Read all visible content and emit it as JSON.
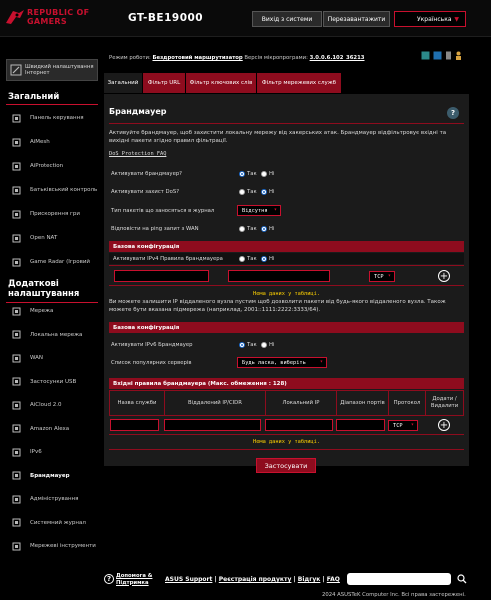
{
  "header": {
    "brand_line1": "REPUBLIC OF",
    "brand_line2": "GAMERS",
    "model": "GT-BE19000",
    "logout": "Вихід з системи",
    "reboot": "Перезавантажити",
    "language": "Українська"
  },
  "sidebar": {
    "quick_setup": "Швидкий налаштування Інтернет",
    "general_title": "Загальний",
    "general_items": [
      {
        "label": "Панель керування",
        "icon": "dashboard-icon"
      },
      {
        "label": "AiMesh",
        "icon": "mesh-icon"
      },
      {
        "label": "AiProtection",
        "icon": "shield-icon"
      },
      {
        "label": "Батьківський контроль",
        "icon": "parental-icon"
      },
      {
        "label": "Прискорення гри",
        "icon": "game-boost-icon"
      },
      {
        "label": "Open NAT",
        "icon": "nat-icon"
      },
      {
        "label": "Game Radar (Ігровий",
        "icon": "radar-icon"
      }
    ],
    "advanced_title": "Додаткові налаштування",
    "advanced_items": [
      {
        "label": "Мережа",
        "icon": "network-icon"
      },
      {
        "label": "Локальна мережа",
        "icon": "lan-icon"
      },
      {
        "label": "WAN",
        "icon": "globe-icon"
      },
      {
        "label": "Застосунки USB",
        "icon": "usb-icon"
      },
      {
        "label": "AiCloud 2.0",
        "icon": "cloud-icon"
      },
      {
        "label": "Amazon Alexa",
        "icon": "alexa-icon"
      },
      {
        "label": "IPv6",
        "icon": "ipv6-icon"
      },
      {
        "label": "Брандмауер",
        "icon": "firewall-icon",
        "active": true
      },
      {
        "label": "Адміністрування",
        "icon": "admin-icon"
      },
      {
        "label": "Системний журнал",
        "icon": "log-icon"
      },
      {
        "label": "Мережеві інструменти",
        "icon": "tools-icon"
      }
    ]
  },
  "topinfo": {
    "mode_label": "Режим роботи:",
    "mode_value": "Бездротовий маршрутизатор",
    "fw_label": "Версія мікропрограми:",
    "fw_value": "3.0.0.6.102_36213"
  },
  "tabs": [
    "Загальний",
    "Фільтр URL",
    "Фільтр ключових слів",
    "Фільтр мережевих служб"
  ],
  "panel": {
    "title": "Брандмауер",
    "description": "Активуйте брандмауер, щоб захистити локальну мережу від хакерських атак. Брандмауер відфільтровує вхідні та вихідні пакети згідно правил фільтрації.",
    "faq": "DoS Protection FAQ",
    "settings": [
      {
        "label": "Активувати брандмауер?",
        "type": "radio",
        "value": "yes"
      },
      {
        "label": "Активувати захист DoS?",
        "type": "radio",
        "value": "no"
      },
      {
        "label": "Тип пакетів що заносяться в журнал",
        "type": "select",
        "value": "Відсутня"
      },
      {
        "label": "Відповісти на ping запит з WAN",
        "type": "radio",
        "value": "no"
      }
    ],
    "yes": "Так",
    "no": "Ні",
    "basic_config": "Базова конфігурація",
    "ipv4_rules_label": "Активувати IPv4 Правила брандмауера",
    "ipv4_rules_value": "no",
    "protocol_default": "TCP",
    "no_data": "Нема даних у таблиці.",
    "ipv6_note": "Ви можете залишити IP віддаленого вузла пустим щоб дозволити пакети від будь-якого віддаленого вузла. Також можете бути вказана підмережа (наприклад, 2001::1111:2222:3333/64).",
    "basic_config2": "Базова конфігурація",
    "ipv6_fw_label": "Активувати IPv6 Брандмауер",
    "ipv6_fw_value": "yes",
    "services_label": "Список популярних серверів",
    "services_value": "Будь ласка, виберіть",
    "inbound_title": "Вхідні правила брандмауера (Макс. обмеження : 128)",
    "columns": [
      "Назва служби",
      "Віддалений IP/CIDR",
      "Локальний IP",
      "Діапазон портів",
      "Протокол",
      "Додати / Видалити"
    ],
    "apply": "Застосувати"
  },
  "footer": {
    "help_line1": "Допомога &",
    "help_line2": "Підтримка",
    "links": [
      "ASUS Support",
      "Реєстрація продукту",
      "Відгук",
      "FAQ"
    ],
    "copyright": "2024 ASUSTeK Computer Inc. Всі права застережені."
  },
  "colors": {
    "accent": "#c8102e",
    "bar": "#8e0c1e",
    "yellow": "#ffd200"
  }
}
